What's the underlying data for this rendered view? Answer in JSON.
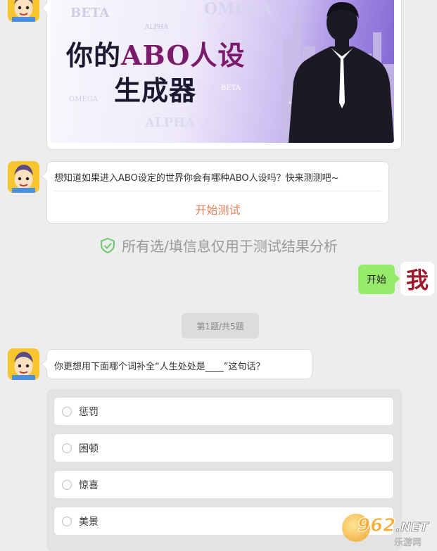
{
  "banner": {
    "title_line1_a": "你的",
    "title_line1_b": "ABO人设",
    "title_line2": "生成器",
    "watermarks": [
      "BETA",
      "OMEGA",
      "ALPHA",
      "OMEGA",
      "BETA",
      "ALPHA"
    ]
  },
  "intro": {
    "question_text": "想知道如果进入ABO设定的世界你会有哪种ABO人设吗？快来测测吧~",
    "start_link": "开始测试"
  },
  "privacy_notice": "所有选/填信息仅用于测试结果分析",
  "user_message": {
    "text": "开始",
    "avatar_text": "我"
  },
  "progress_pill": "第1题/共5题",
  "question": {
    "text": "你更想用下面哪个词补全“人生处处是____”这句话？",
    "options": [
      "惩罚",
      "困顿",
      "惊喜",
      "美景"
    ]
  },
  "watermark_logo": {
    "brand": "962",
    "suffix": ".NET",
    "sub": "乐游网"
  },
  "colors": {
    "accent": "#e8805a",
    "user_bubble": "#95ec69",
    "shield": "#6bc96b",
    "title_purple": "#7b1a6b",
    "title_dark": "#1c1830"
  }
}
